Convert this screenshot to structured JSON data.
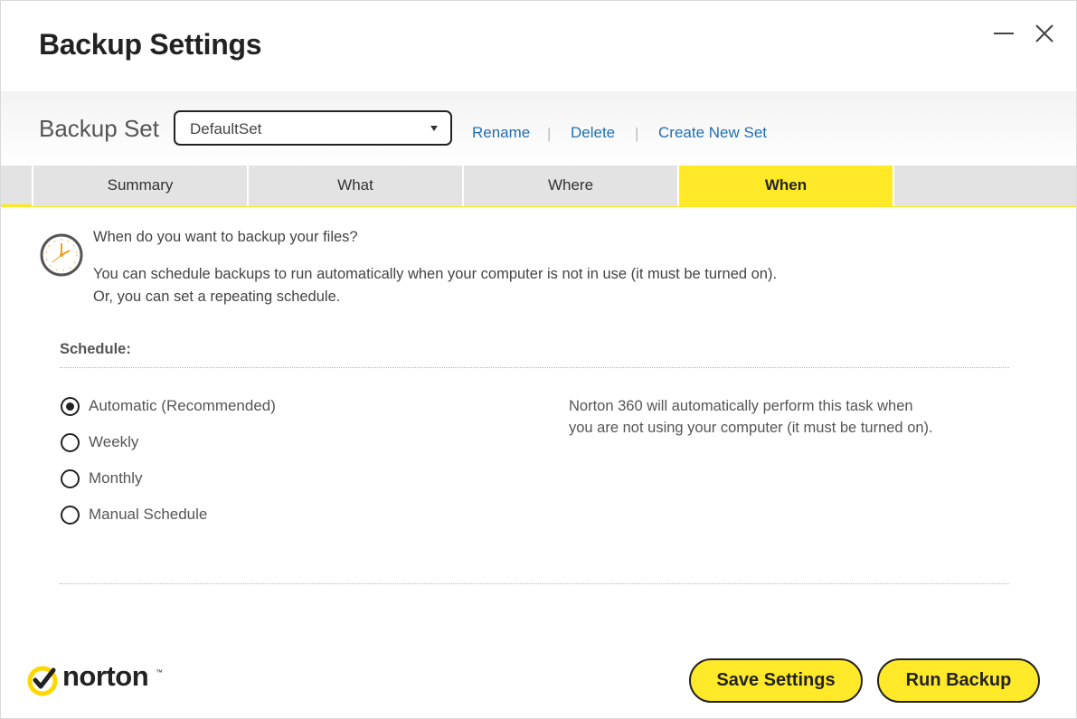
{
  "window": {
    "title": "Backup Settings"
  },
  "backup_set": {
    "label": "Backup Set",
    "selected": "DefaultSet",
    "links": {
      "rename": "Rename",
      "delete": "Delete",
      "create": "Create New Set"
    },
    "separator": "|"
  },
  "tabs": [
    {
      "label": "Summary",
      "active": false
    },
    {
      "label": "What",
      "active": false
    },
    {
      "label": "Where",
      "active": false
    },
    {
      "label": "When",
      "active": true
    }
  ],
  "when": {
    "question": "When do you want to backup your files?",
    "description_line1": "You can schedule backups to run automatically when your computer is not in use (it must be turned on).",
    "description_line2": "Or, you can set a repeating schedule.",
    "schedule_label": "Schedule:",
    "options": [
      {
        "label": "Automatic (Recommended)",
        "selected": true
      },
      {
        "label": "Weekly",
        "selected": false
      },
      {
        "label": "Monthly",
        "selected": false
      },
      {
        "label": "Manual Schedule",
        "selected": false
      }
    ],
    "info_text": "Norton 360 will automatically perform this task when you are not using your computer (it must be turned on)."
  },
  "footer": {
    "brand": "norton",
    "save_label": "Save Settings",
    "run_label": "Run Backup"
  },
  "colors": {
    "accent": "#ffe928",
    "link": "#1f6fb5",
    "text": "#444444"
  },
  "icons": {
    "minimize": "minimize-icon",
    "close": "close-icon",
    "clock": "clock-icon",
    "dropdown": "chevron-down-icon",
    "logo": "norton-check-icon"
  }
}
